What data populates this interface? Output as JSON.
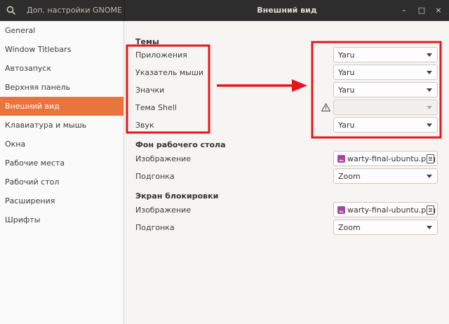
{
  "window": {
    "sidebar_title": "Доп. настройки GNOME",
    "title": "Внешний вид",
    "search_icon": "search-icon",
    "minimize_glyph": "–",
    "maximize_glyph": "□",
    "close_glyph": "×"
  },
  "sidebar": {
    "items": [
      {
        "label": "General",
        "active": false
      },
      {
        "label": "Window Titlebars",
        "active": false
      },
      {
        "label": "Автозапуск",
        "active": false
      },
      {
        "label": "Верхняя панель",
        "active": false
      },
      {
        "label": "Внешний вид",
        "active": true
      },
      {
        "label": "Клавиатура и мышь",
        "active": false
      },
      {
        "label": "Окна",
        "active": false
      },
      {
        "label": "Рабочие места",
        "active": false
      },
      {
        "label": "Рабочий стол",
        "active": false
      },
      {
        "label": "Расширения",
        "active": false
      },
      {
        "label": "Шрифты",
        "active": false
      }
    ]
  },
  "themes": {
    "title": "Темы",
    "applications": {
      "label": "Приложения",
      "value": "Yaru"
    },
    "cursor": {
      "label": "Указатель мыши",
      "value": "Yaru"
    },
    "icons": {
      "label": "Значки",
      "value": "Yaru"
    },
    "shell": {
      "label": "Тема Shell",
      "value": "",
      "disabled": true,
      "warning_icon": "warning-icon"
    },
    "sound": {
      "label": "Звук",
      "value": "Yaru"
    }
  },
  "background": {
    "title": "Фон рабочего стола",
    "image": {
      "label": "Изображение",
      "file": "warty-final-ubuntu.png"
    },
    "adjustment": {
      "label": "Подгонка",
      "value": "Zoom"
    }
  },
  "lockscreen": {
    "title": "Экран блокировки",
    "image": {
      "label": "Изображение",
      "file": "warty-final-ubuntu.png"
    },
    "adjustment": {
      "label": "Подгонка",
      "value": "Zoom"
    }
  },
  "annotation": {
    "highlight_color": "#e8161a"
  }
}
